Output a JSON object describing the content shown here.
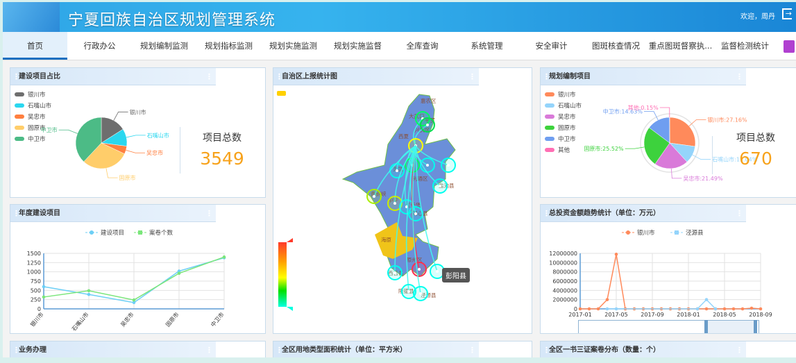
{
  "header": {
    "title": "宁夏回族自治区规划管理系统",
    "welcome": "欢迎，周丹",
    "logout_icon": "logout-icon"
  },
  "nav": {
    "items": [
      "首页",
      "行政办公",
      "规划编制监测",
      "规划指标监测",
      "规划实施监测",
      "规划实施监督",
      "全库查询",
      "系统管理",
      "安全审计",
      "图斑核查情况",
      "重点图斑督察执...",
      "监督检测统计"
    ],
    "active": "首页",
    "skin_icon": "shirt-icon"
  },
  "panels": {
    "construction_share": {
      "title": "建设项目占比",
      "total_label": "项目总数",
      "total": "3549"
    },
    "report_map": {
      "title": "自治区上报统计图",
      "tooltip": "彭阳县",
      "labels": [
        "惠农区",
        "大武口",
        "平罗",
        "西夏",
        "兴庆区",
        "灵武",
        "利通区",
        "盐池县",
        "青铜峡",
        "同心县",
        "红寺堡",
        "中宁",
        "海原",
        "原州区",
        "西吉县",
        "彭阳县",
        "隆德县",
        "泾源县"
      ]
    },
    "plan_projects": {
      "title": "规划编制项目",
      "total_label": "项目总数",
      "total": "670"
    },
    "annual_projects": {
      "title": "年度建设项目"
    },
    "investment_trend": {
      "title": "总投资金额趋势统计（单位：万元）"
    },
    "business": {
      "title": "业务办理"
    },
    "land_area": {
      "title": "全区用地类型面积统计（单位：平方米）"
    },
    "certificates": {
      "title": "全区一书三证案卷分布（数量：个）"
    }
  },
  "chart_data": [
    {
      "type": "pie",
      "panel": "construction_share",
      "legend_placement": "top-left",
      "categories": [
        "银川市",
        "石嘴山市",
        "吴忠市",
        "固原市",
        "中卫市"
      ],
      "values_percent": [
        16,
        11,
        5,
        30,
        38
      ],
      "colors": [
        "#6e6e6e",
        "#2ad7ef",
        "#ff7f3f",
        "#ffcd6a",
        "#4cbb86"
      ]
    },
    {
      "type": "pie",
      "panel": "plan_projects",
      "legend_placement": "top-left",
      "categories": [
        "银川市",
        "石嘴山市",
        "吴忠市",
        "固原市",
        "中卫市",
        "其他"
      ],
      "values_percent": [
        27.16,
        11.04,
        21.49,
        25.52,
        14.63,
        0.15
      ],
      "labels": [
        "银川市:27.16%",
        "石嘴山市:11.04%",
        "吴忠市:21.49%",
        "固原市:25.52%",
        "中卫市:14.63%",
        "其他:0.15%"
      ],
      "colors": [
        "#ff8a5b",
        "#94d4fb",
        "#d97ad9",
        "#3dd23d",
        "#6f9ef0",
        "#ff6fb4"
      ]
    },
    {
      "type": "line",
      "panel": "annual_projects",
      "categories": [
        "银川市",
        "石嘴山市",
        "吴忠市",
        "固原市",
        "中卫市"
      ],
      "ylim": [
        0,
        1500
      ],
      "yticks": [
        0,
        250,
        500,
        750,
        1000,
        1250,
        1500
      ],
      "grid": true,
      "legend_placement": "top",
      "series": [
        {
          "name": "建设项目",
          "values": [
            600,
            390,
            170,
            1020,
            1380
          ],
          "color": "#6ccff6"
        },
        {
          "name": "案卷个数",
          "values": [
            320,
            490,
            240,
            960,
            1400
          ],
          "color": "#7be67b"
        }
      ]
    },
    {
      "type": "line",
      "panel": "investment_trend",
      "x": [
        "2017-01",
        "2017-02",
        "2017-03",
        "2017-04",
        "2017-05",
        "2017-06",
        "2017-07",
        "2017-08",
        "2017-09",
        "2017-10",
        "2017-11",
        "2017-12",
        "2018-01",
        "2018-02",
        "2018-03",
        "2018-04",
        "2018-05",
        "2018-06",
        "2018-07",
        "2018-08",
        "2018-09"
      ],
      "xticks": [
        "2017-01",
        "2017-05",
        "2017-09",
        "2018-01",
        "2018-05",
        "2018-09"
      ],
      "ylim": [
        0,
        12000000
      ],
      "yticks": [
        0,
        2000000,
        4000000,
        6000000,
        8000000,
        10000000,
        12000000
      ],
      "grid": true,
      "legend_placement": "top",
      "series": [
        {
          "name": "银川市",
          "values": [
            0,
            0,
            0,
            2000000,
            11800000,
            0,
            0,
            0,
            0,
            0,
            0,
            0,
            0,
            0,
            0,
            0,
            0,
            0,
            0,
            150000,
            0
          ],
          "color": "#ff8a5b"
        },
        {
          "name": "泾源县",
          "values": [
            null,
            null,
            null,
            0,
            0,
            null,
            null,
            null,
            null,
            null,
            null,
            null,
            null,
            0,
            2000000,
            0,
            null,
            null,
            null,
            null,
            null
          ],
          "color": "#94d4fb"
        }
      ]
    }
  ]
}
